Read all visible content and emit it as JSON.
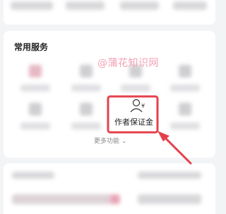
{
  "services": {
    "title": "常用服务",
    "deposit_label": "作者保证金",
    "more_label": "更多功能"
  },
  "watermark": "@蒲花知识网",
  "colors": {
    "annotation": "#e4414b",
    "watermark": "#f4a0b4"
  },
  "icons": {
    "deposit": "user-yen-icon",
    "more": "chevron-down-icon"
  }
}
